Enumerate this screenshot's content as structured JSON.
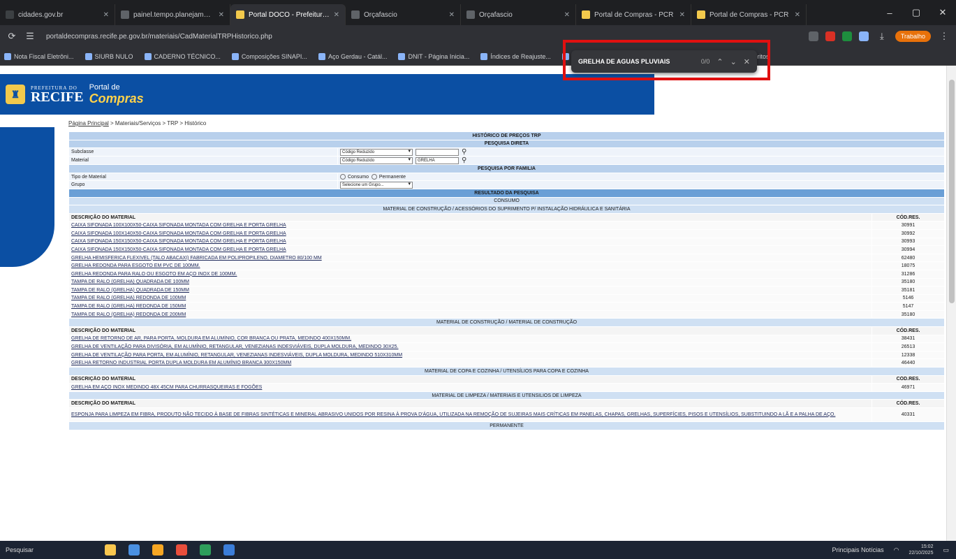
{
  "browser": {
    "tabs": [
      {
        "label": "cidades.gov.br",
        "color": "#3c4043"
      },
      {
        "label": "painel.tempo.planejamento...",
        "color": "#5f6368"
      },
      {
        "label": "Portal DOCO - Prefeitura do Ri...",
        "color": "#f2c94c"
      },
      {
        "label": "Orçafascio",
        "color": "#5f6368"
      },
      {
        "label": "Orçafascio",
        "color": "#5f6368"
      },
      {
        "label": "Portal de Compras - PCR",
        "color": "#f2c94c"
      },
      {
        "label": "Portal de Compras - PCR",
        "color": "#f2c94c"
      }
    ],
    "active_tab": 2,
    "url": "portaldecompras.recife.pe.gov.br/materiais/CadMaterialTRPHistorico.php",
    "profile_label": "Trabalho",
    "bookmarks": [
      "Nota Fiscal Eletrôni...",
      "SIURB NULO",
      "CADERNO TÉCNICO...",
      "Composições SINAPI...",
      "Aço Gerdau - Catál...",
      "DNIT - Página Inicia...",
      "Índices de Reajuste...",
      "Projeto Sinal...",
      "TCE-PE - Google Dri...",
      "Todos os favoritos"
    ],
    "find": {
      "query": "GRELHA DE AGUAS PLUVIAIS",
      "count": "0/0"
    }
  },
  "site": {
    "logo_small": "PREFEITURA DO",
    "logo_big": "RECIFE",
    "portal_line1": "Portal de",
    "portal_line2": "Compras",
    "breadcrumb_home": "Página Principal",
    "breadcrumb_rest": " > Materiais/Serviços > TRP > Histórico"
  },
  "form": {
    "title": "HISTÓRICO DE PREÇOS TRP",
    "direct": "PESQUISA DIRETA",
    "subclasse_label": "Subclasse",
    "subclasse_select": "Código Reduzido",
    "subclasse_value": "",
    "material_label": "Material",
    "material_select": "Código Reduzido",
    "material_value": "GRELHA",
    "familia": "PESQUISA POR FAMILIA",
    "tipo_label": "Tipo de Material",
    "tipo_opt1": "Consumo",
    "tipo_opt2": "Permanente",
    "grupo_label": "Grupo",
    "grupo_select": "Selecione um Grupo..."
  },
  "results": {
    "title": "RESULTADO DA PESQUISA",
    "consumo": "CONSUMO",
    "permanente": "PERMANENTE",
    "col_desc": "DESCRIÇÃO DO MATERIAL",
    "col_cod": "CÓD.RES.",
    "groups": [
      {
        "name": "MATERIAL DE CONSTRUÇÃO / ACESSÓRIOS DO SUPRIMENTO P/ INSTALAÇÃO HIDRÁULICA E SANITÁRIA",
        "items": [
          {
            "desc": "CAIXA SIFONADA 100X100X50-CAIXA SIFONADA MONTADA COM GRELHA E PORTA GRELHA",
            "cod": "30991"
          },
          {
            "desc": "CAIXA SIFONADA 100X140X50-CAIXA SIFONADA MONTADA COM GRELHA E PORTA GRELHA",
            "cod": "30992"
          },
          {
            "desc": "CAIXA SIFONADA 150X150X50-CAIXA SIFONADA MONTADA COM GRELHA E PORTA GRELHA",
            "cod": "30993"
          },
          {
            "desc": "CAIXA SIFONADA 150X150X50-CAIXA SIFONADA MONTADA COM GRELHA E PORTA GRELHA",
            "cod": "30994"
          },
          {
            "desc": "GRELHA HEMISFERICA FLEXIVEL (TALO ABACAXI) FABRICADA EM POLIPROPILENO, DIAMETRO 80/100 MM",
            "cod": "62480"
          },
          {
            "desc": "GRELHA REDONDA PARA ESGOTO EM PVC DE 100MM.",
            "cod": "18075"
          },
          {
            "desc": "GRELHA REDONDA PARA RALO OU ESGOTO EM AÇO INOX DE 100MM.",
            "cod": "31286"
          },
          {
            "desc": "TAMPA DE RALO (GRELHA) QUADRADA DE 100MM",
            "cod": "35180"
          },
          {
            "desc": "TAMPA DE RALO (GRELHA) QUADRADA DE 150MM",
            "cod": "35181"
          },
          {
            "desc": "TAMPA DE RALO (GRELHA) REDONDA DE 100MM",
            "cod": "5146"
          },
          {
            "desc": "TAMPA DE RALO (GRELHA) REDONDA DE 150MM",
            "cod": "5147"
          },
          {
            "desc": "TAMPA DE RALO (GRELHA) REDONDA DE 200MM",
            "cod": "35180"
          }
        ]
      },
      {
        "name": "MATERIAL DE CONSTRUÇÃO / MATERIAL DE CONSTRUÇÃO",
        "items": [
          {
            "desc": "GRELHA DE RETORNO DE AR, PARA PORTA, MOLDURA EM ALUMÍNIO, COR BRANCA OU PRATA, MEDINDO 400X150MM.",
            "cod": "38431"
          },
          {
            "desc": "GRELHA DE VENTILAÇÃO PARA DIVISÓRIA, EM ALUMÍNIO, RETANGULAR, VENEZIANAS INDESVIÁVEIS, DUPLA MOLDURA, MEDINDO 30X25.",
            "cod": "26513"
          },
          {
            "desc": "GRELHA DE VENTILAÇÃO PARA PORTA, EM ALUMÍNIO, RETANGULAR, VENEZIANAS INDESVIÁVEIS, DUPLA MOLDURA, MEDINDO 510X310MM",
            "cod": "12338"
          },
          {
            "desc": "GRELHA RETORNO INDUSTRIAL PORTA DUPLA MOLDURA EM ALUMÍNIO BRANCA 300X150MM",
            "cod": "46440"
          }
        ]
      },
      {
        "name": "MATERIAL DE COPA E COZINHA / UTENSÍLIOS PARA COPA E COZINHA",
        "items": [
          {
            "desc": "GRELHA EM AÇO INOX MEDINDO 48X 45CM PARA CHURRASQUEIRAS E FOGÕES",
            "cod": "46971"
          }
        ]
      },
      {
        "name": "MATERIAL DE LIMPEZA / MATERIAIS E UTENSILIOS DE LIMPEZA",
        "items": [
          {
            "desc": "ESPONJA PARA LIMPEZA EM FIBRA, PRODUTO NÃO TECIDO À BASE DE FIBRAS SINTÉTICAS E MINERAL ABRASIVO UNIDOS POR RESINA À PROVA D'ÁGUA, UTILIZADA NA REMOÇÃO DE SUJEIRAS MAIS CRÍTICAS EM PANELAS, CHAPAS, GRELHAS, SUPERFÍCIES, PISOS E UTENSÍLIOS, SUBSTITUINDO A LÃ E A PALHA DE AÇO.",
            "cod": "40331"
          }
        ]
      }
    ]
  },
  "taskbar": {
    "search": "Pesquisar",
    "news": "Principais Notícias",
    "time": "15:02",
    "date": "22/10/2025"
  }
}
